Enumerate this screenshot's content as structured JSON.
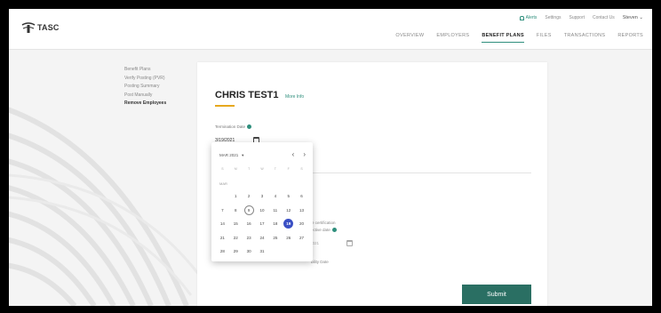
{
  "app": {
    "logo_text": "TASC"
  },
  "util_nav": {
    "alerts": "Alerts",
    "settings": "Settings",
    "support": "Support",
    "contact": "Contact Us",
    "user": "Steven ⌄"
  },
  "main_nav": [
    "OVERVIEW",
    "EMPLOYERS",
    "BENEFIT PLANS",
    "FILES",
    "TRANSACTIONS",
    "REPORTS"
  ],
  "main_nav_active": "BENEFIT PLANS",
  "side_menu": [
    "Benefit Plans",
    "Verify Posting (PVR)",
    "Posting Summary",
    "Post Manually",
    "Remove Employees"
  ],
  "side_menu_active": "Remove Employees",
  "employee": {
    "name": "CHRIS TEST1",
    "more_info": "More Info"
  },
  "termination": {
    "label": "Termination Date",
    "value": "3/19/2021"
  },
  "hidden_fields": {
    "certify_fragment": "ie certification",
    "effective_fragment": "ective date",
    "date_fragment": "2021",
    "final_fragment": "bility Date"
  },
  "datepicker": {
    "month_label": "MAR 2021",
    "prev": "‹",
    "next": "›",
    "weekdays": [
      "S",
      "M",
      "T",
      "W",
      "T",
      "F",
      "S"
    ],
    "section_label": "MAR",
    "weeks": [
      [
        "",
        "1",
        "2",
        "3",
        "4",
        "5",
        "6"
      ],
      [
        "7",
        "8",
        "9",
        "10",
        "11",
        "12",
        "13"
      ],
      [
        "14",
        "15",
        "16",
        "17",
        "18",
        "19",
        "20"
      ],
      [
        "21",
        "22",
        "23",
        "24",
        "25",
        "26",
        "27"
      ],
      [
        "28",
        "29",
        "30",
        "31",
        "",
        "",
        ""
      ]
    ],
    "today": "9",
    "selected": "19"
  },
  "submit_label": "Submit",
  "colors": {
    "accent": "#2f8f7d",
    "submit": "#2a6f63",
    "selected_day": "#3a4fc4",
    "underline": "#e6a81e"
  }
}
